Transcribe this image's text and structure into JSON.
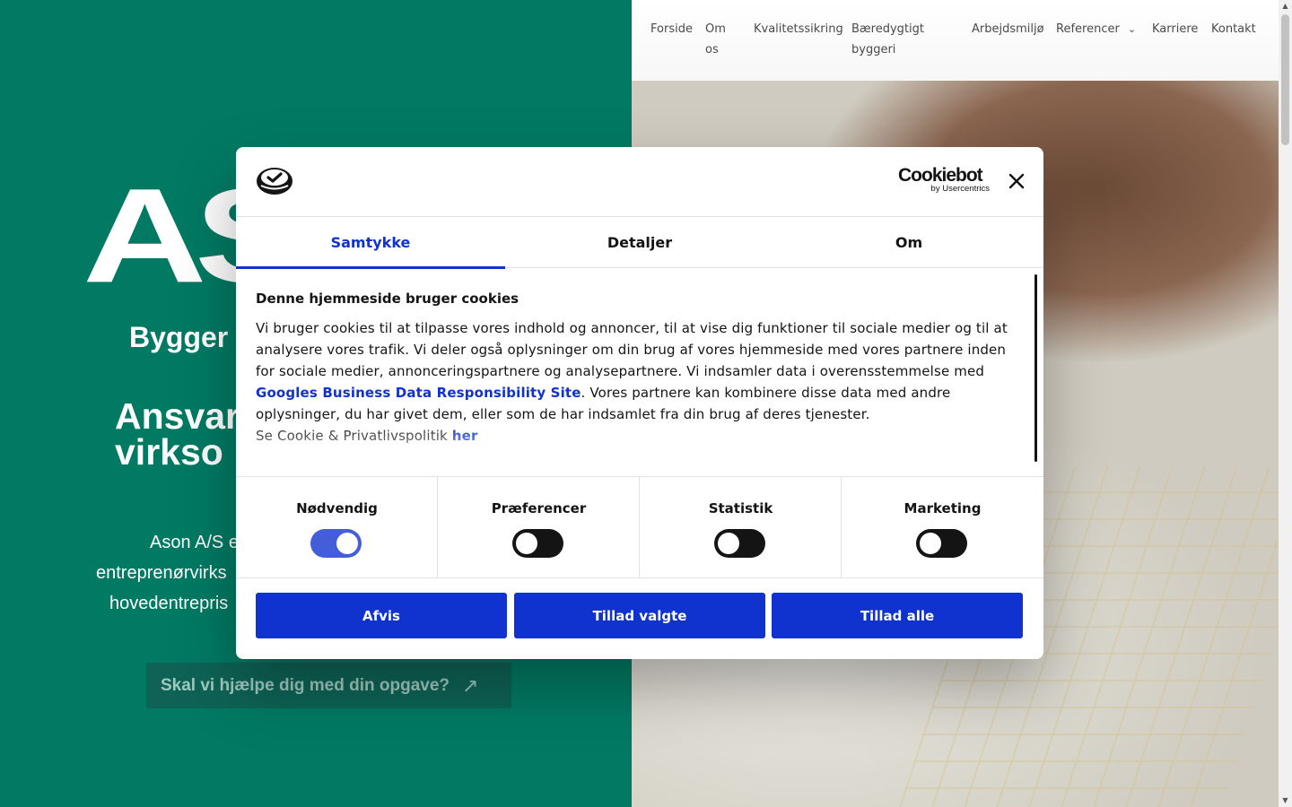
{
  "nav": {
    "items": [
      "Forside",
      "Om\nos",
      "Kvalitetssikring",
      "Bæredygtigt\nbyggeri",
      "Arbejdsmiljø",
      "Referencer",
      "Karriere",
      "Kontakt"
    ]
  },
  "hero": {
    "logo": "AS",
    "tagline": "Bygger",
    "heading_lines": [
      "Ansvar",
      "virkso"
    ],
    "text_lines": [
      "Ason A/S e",
      "entreprenørvirks",
      "hovedentrepris"
    ],
    "cta_label": "Skal vi hjælpe dig med din opgave?"
  },
  "dialog": {
    "brand_name": "Cookiebot",
    "brand_sub": "by Usercentrics",
    "tabs": [
      "Samtykke",
      "Detaljer",
      "Om"
    ],
    "active_tab": "Samtykke",
    "title": "Denne hjemmeside bruger cookies",
    "text_before_link": "Vi bruger cookies til at tilpasse vores indhold og annoncer, til at vise dig funktioner til sociale medier og til at analysere vores trafik. Vi deler også oplysninger om din brug af vores hjemmeside med vores partnere inden for sociale medier, annonceringspartnere og analysepartnere. Vi indsamler data i overensstemmelse med ",
    "link_text": "Googles Business Data Responsibility Site",
    "text_after_link": ". Vores partnere kan kombinere disse data med andre oplysninger, du har givet dem, eller som de har indsamlet fra din brug af deres tjenester.",
    "policy_text": "Se Cookie & Privatlivspolitik ",
    "policy_link": "her",
    "toggles": [
      {
        "label": "Nødvendig",
        "on": true
      },
      {
        "label": "Præferencer",
        "on": false
      },
      {
        "label": "Statistik",
        "on": false
      },
      {
        "label": "Marketing",
        "on": false
      }
    ],
    "buttons": {
      "reject": "Afvis",
      "allow_selected": "Tillad valgte",
      "allow_all": "Tillad alle"
    }
  },
  "colors": {
    "hero_green": "#007a63",
    "accent_blue": "#1032cf"
  }
}
